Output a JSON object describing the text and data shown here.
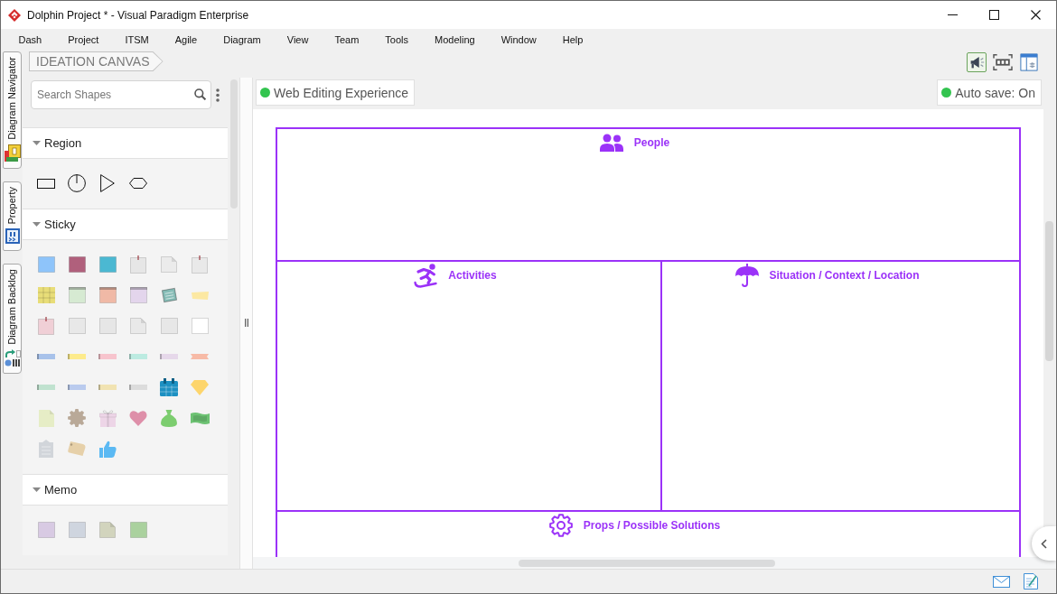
{
  "window": {
    "title": "Dolphin Project * - Visual Paradigm Enterprise"
  },
  "menu": [
    "Dash",
    "Project",
    "ITSM",
    "Agile",
    "Diagram",
    "View",
    "Team",
    "Tools",
    "Modeling",
    "Window",
    "Help"
  ],
  "side_tabs": [
    {
      "label": "Diagram Navigator",
      "kind": "navigator"
    },
    {
      "label": "Property",
      "kind": "property"
    },
    {
      "label": "Diagram Backlog",
      "kind": "backlog"
    }
  ],
  "breadcrumb": {
    "label": "IDEATION CANVAS"
  },
  "toolbar": [
    {
      "kind": "megaphone",
      "selected": true
    },
    {
      "kind": "fit",
      "selected": false
    },
    {
      "kind": "panel",
      "selected": false
    }
  ],
  "palette": {
    "search": {
      "placeholder": "Search Shapes"
    },
    "sections": [
      {
        "title": "Region",
        "expanded": true,
        "items": [
          {
            "kind": "rectangle"
          },
          {
            "kind": "circle"
          },
          {
            "kind": "triangle"
          },
          {
            "kind": "hexagon"
          }
        ]
      },
      {
        "title": "Sticky",
        "expanded": true,
        "items": [
          {
            "kind": "note",
            "color": "#8ec4fa"
          },
          {
            "kind": "note",
            "color": "#b0607c"
          },
          {
            "kind": "note",
            "color": "#4bb8d2"
          },
          {
            "kind": "pinned-note",
            "color": "#e6e6e6"
          },
          {
            "kind": "curled-note",
            "color": "#ebebeb"
          },
          {
            "kind": "pinned-note",
            "color": "#e9e9e9"
          },
          {
            "kind": "lined-note",
            "color": "#e8dd78"
          },
          {
            "kind": "tab-note",
            "color": "#d6ead2"
          },
          {
            "kind": "tab-note",
            "color": "#f0b9a6"
          },
          {
            "kind": "tab-note",
            "color": "#e3d5ec"
          },
          {
            "kind": "stack",
            "color": "#86bcb6"
          },
          {
            "kind": "strip",
            "color": "#fce8a2"
          },
          {
            "kind": "pinned-note",
            "color": "#f0cfd6"
          },
          {
            "kind": "note",
            "color": "#e8e8e8"
          },
          {
            "kind": "note",
            "color": "#e6e6e6"
          },
          {
            "kind": "curled-note",
            "color": "#e9e9e9"
          },
          {
            "kind": "note",
            "color": "#e7e7e7"
          },
          {
            "kind": "note",
            "color": "#ffffff"
          },
          {
            "kind": "tape",
            "color": "#a8c2ea"
          },
          {
            "kind": "tape",
            "color": "#fdeb8c"
          },
          {
            "kind": "tape",
            "color": "#f7c4cd"
          },
          {
            "kind": "tape",
            "color": "#bcebe1"
          },
          {
            "kind": "tape",
            "color": "#e6d8ea"
          },
          {
            "kind": "ribbon",
            "color": "#f7baa6"
          },
          {
            "kind": "tape",
            "color": "#c0e2cf"
          },
          {
            "kind": "tape",
            "color": "#bacbee"
          },
          {
            "kind": "tape",
            "color": "#f1e3b2"
          },
          {
            "kind": "tape",
            "color": "#dcdcdc"
          },
          {
            "kind": "calendar",
            "color": "#1d90c2"
          },
          {
            "kind": "diamond",
            "color": "#fdd56c"
          },
          {
            "kind": "page",
            "color": "#e6edc6"
          },
          {
            "kind": "gear",
            "color": "#b9a998"
          },
          {
            "kind": "gift",
            "color": "#edd5e7"
          },
          {
            "kind": "heart",
            "color": "#de8fa9"
          },
          {
            "kind": "bag",
            "color": "#7ccd6f"
          },
          {
            "kind": "banknote",
            "color": "#6dc273"
          },
          {
            "kind": "clipboard",
            "color": "#d1d5da"
          },
          {
            "kind": "tag",
            "color": "#e6d0a9"
          },
          {
            "kind": "thumbs-up",
            "color": "#5bb9f3"
          }
        ]
      },
      {
        "title": "Memo",
        "expanded": true,
        "items": [
          {
            "kind": "note",
            "color": "#d8cae3"
          },
          {
            "kind": "note",
            "color": "#cfd5df"
          },
          {
            "kind": "curled-note",
            "color": "#d2d4bd"
          },
          {
            "kind": "note",
            "color": "#aad19e"
          }
        ]
      }
    ]
  },
  "canvas": {
    "chips": [
      {
        "label": "Web Editing Experience"
      },
      {
        "label": "Auto save: On"
      }
    ],
    "rows": [
      [
        {
          "title": "People",
          "kind": "people"
        }
      ],
      [
        {
          "title": "Activities",
          "kind": "activities"
        },
        {
          "title": "Situation / Context / Location",
          "kind": "situation"
        }
      ],
      [
        {
          "title": "Props / Possible Solutions",
          "kind": "props"
        }
      ]
    ]
  }
}
